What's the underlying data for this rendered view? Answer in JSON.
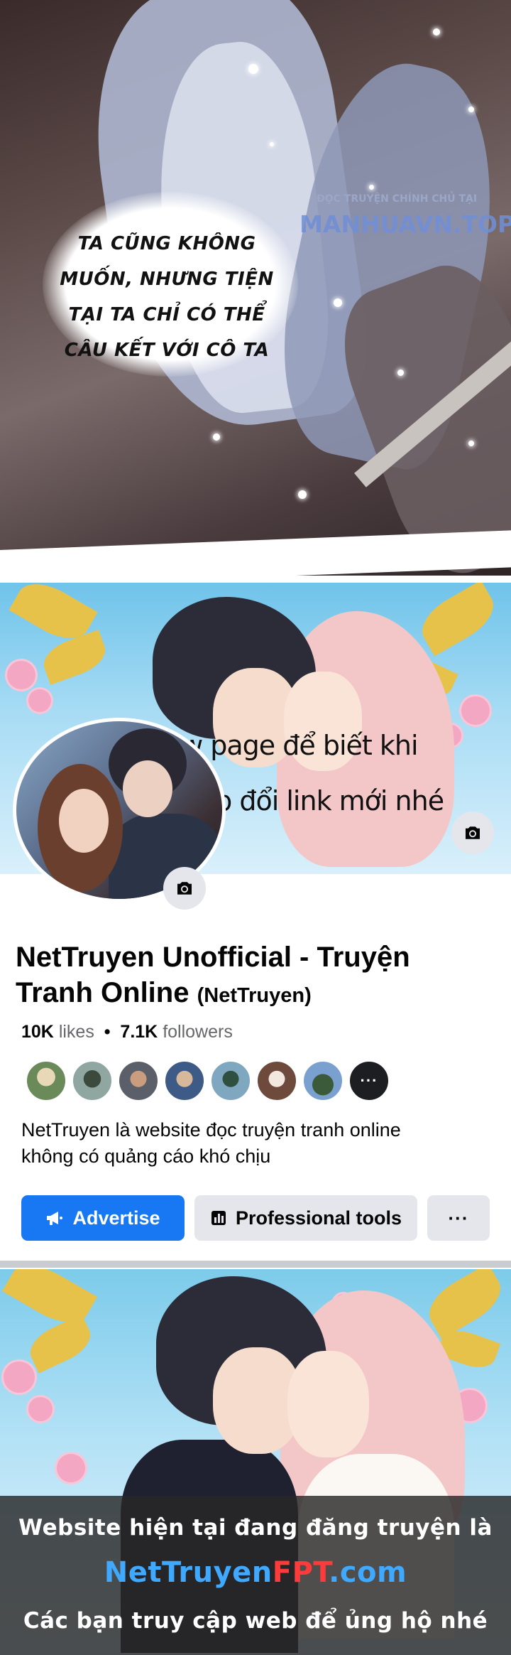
{
  "manga": {
    "speech_lines": [
      "TA CŨNG KHÔNG",
      "MUỐN, NHƯNG TIỆN",
      "TẠI TA CHỈ CÓ THỂ",
      "CÂU KẾT VỚI CÔ TA"
    ],
    "watermark_small": "ĐỌC TRUYỆN CHÍNH CHỦ TẠI",
    "watermark_big": "MANHUAVN.TOP"
  },
  "cover": {
    "text_line1": "Follow page để biết khi",
    "text_line2": "nào web đổi link mới nhé"
  },
  "page": {
    "name": "NetTruyen Unofficial - Truyện Tranh Online",
    "handle": "(NetTruyen)",
    "likes_count": "10K",
    "likes_label": "likes",
    "separator": "•",
    "followers_count": "7.1K",
    "followers_label": "followers",
    "more_friends": "···",
    "bio_line1": "NetTruyen là website đọc truyện tranh online",
    "bio_line2": "không có quảng cáo khó chịu"
  },
  "actions": {
    "advertise": "Advertise",
    "professional_tools": "Professional tools",
    "more": "···"
  },
  "promo": {
    "line1": "Website hiện tại đang đăng truyện là",
    "domain_part1": "NetTruyen",
    "domain_part2": "FPT",
    "domain_part3": ".com",
    "line3": "Các bạn truy cập web để ủng hộ nhé"
  },
  "colors": {
    "facebook_blue": "#1877f2",
    "button_gray": "#e4e6eb",
    "domain_blue": "#3fa8ff",
    "domain_red": "#ff3a3a"
  }
}
